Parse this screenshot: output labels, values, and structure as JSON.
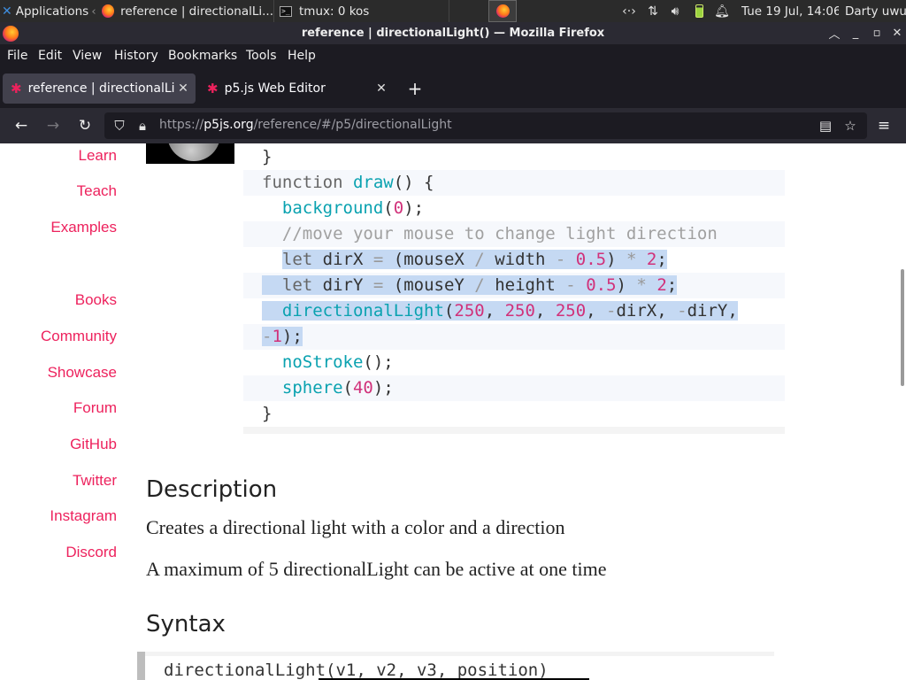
{
  "panel": {
    "applications_label": "Applications",
    "tasks": [
      {
        "label": "reference | directionalLi..."
      },
      {
        "label": "tmux: 0 kos"
      }
    ],
    "datetime": "Tue 19 Jul, 14:06",
    "user": "Darty uwu"
  },
  "window": {
    "title": "reference | directionalLight() — Mozilla Firefox"
  },
  "menubar": {
    "items": [
      "File",
      "Edit",
      "View",
      "History",
      "Bookmarks",
      "Tools",
      "Help"
    ]
  },
  "tabs": [
    {
      "label": "reference | directionalLight()",
      "active": true
    },
    {
      "label": "p5.js Web Editor",
      "active": false
    }
  ],
  "navbar": {
    "url_prefix": "https://",
    "url_host": "p5js.org",
    "url_path": "/reference/#/p5/directionalLight"
  },
  "sidenav": {
    "items": [
      "Learn",
      "Teach",
      "Examples",
      "Books",
      "Community",
      "Showcase",
      "Forum",
      "GitHub",
      "Twitter",
      "Instagram",
      "Discord"
    ]
  },
  "code": {
    "close_brace_1": "}",
    "function_kw": "function",
    "draw_fn": "draw",
    "draw_rest": "() {",
    "background_fn": "background",
    "background_arg": "0",
    "comment": "//move your mouse to change light direction",
    "let_kw": "let",
    "dirX_var": " dirX ",
    "dirY_var": " dirY ",
    "eq": "=",
    "mouseX": "mouseX",
    "mouseY": "mouseY",
    "div": "/",
    "width": "width",
    "height": "height",
    "minus": "-",
    "half": "0.5",
    "times": "*",
    "two": "2",
    "dl_fn": "directionalLight",
    "v250": "250",
    "neg": "-",
    "dirX": "dirX",
    "dirY": "dirY",
    "one": "1",
    "nostroke_fn": "noStroke",
    "sphere_fn": "sphere",
    "sphere_arg": "40",
    "close_brace_2": "}"
  },
  "description": {
    "heading": "Description",
    "p1": "Creates a directional light with a color and a direction",
    "p2": "A maximum of 5 directionalLight can be active at one time"
  },
  "syntax": {
    "heading": "Syntax",
    "code": "directionalLight(v1, v2, v3, position)"
  },
  "colors": {
    "p5_pink": "#ed225d",
    "code_function": "#0aa2b0",
    "code_number": "#d1317a",
    "selection": "#c5d9f3"
  }
}
